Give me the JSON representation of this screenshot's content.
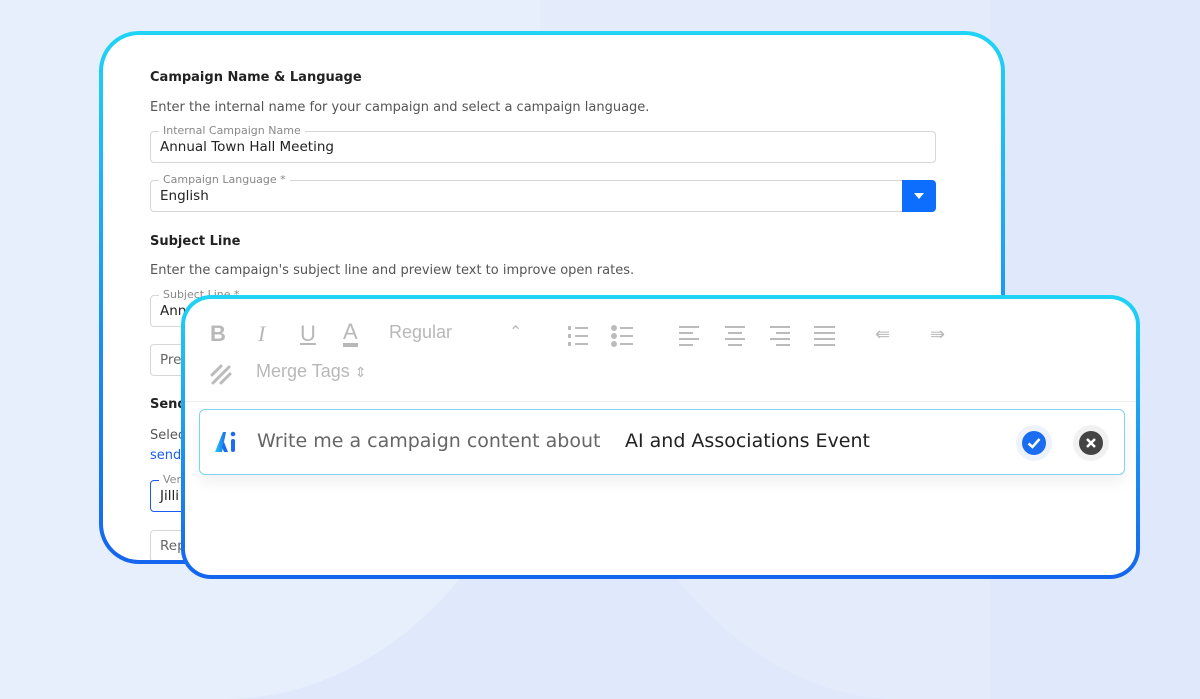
{
  "back": {
    "section1": {
      "title": "Campaign Name & Language",
      "desc": "Enter the internal name for your campaign and select a campaign language."
    },
    "name_field": {
      "label": "Internal Campaign Name",
      "value": "Annual Town Hall Meeting"
    },
    "language_field": {
      "label": "Campaign Language *",
      "value": "English"
    },
    "section2": {
      "title": "Subject Line",
      "desc": "Enter the campaign's subject line and preview text to improve open rates."
    },
    "subject_field": {
      "label": "Subject Line *",
      "value": "Ann"
    },
    "preview_field": {
      "placeholder": "Pre"
    },
    "section3": {
      "title": "Send",
      "desc": "Selec",
      "link": "send"
    },
    "sender_field": {
      "label": "Ver",
      "value": "Jilli"
    },
    "reply_field": {
      "placeholder": "Rep"
    }
  },
  "editor": {
    "toolbar": {
      "bold": "B",
      "italic": "I",
      "underline": "U",
      "color": "A",
      "font_style": "Regular",
      "merge_tags": "Merge Tags"
    },
    "prompt": {
      "prefix": "Write me a campaign content about",
      "value": "AI and Associations Event"
    }
  },
  "colors": {
    "accent": "#0d6efd",
    "border_top": "#20d4f5",
    "border_bottom": "#1565ee",
    "link": "#1a5cf0"
  }
}
